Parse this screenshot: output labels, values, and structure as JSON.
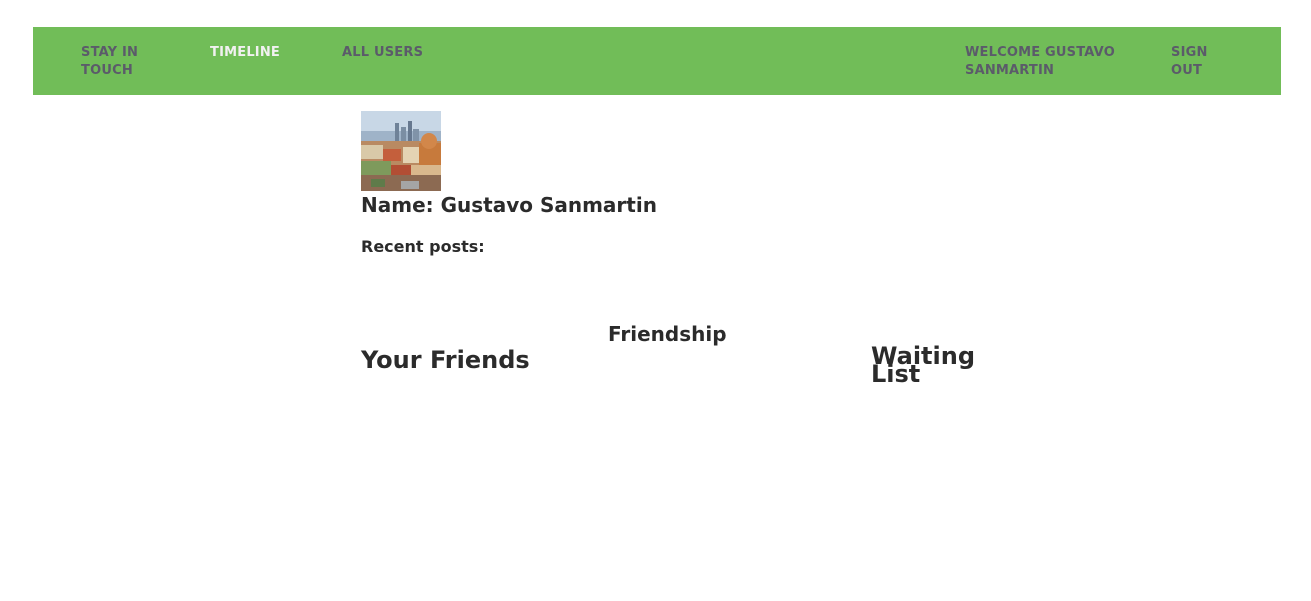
{
  "nav": {
    "brand": "STAY IN TOUCH",
    "timeline": "TIMELINE",
    "all_users": "ALL USERS",
    "welcome": "WELCOME GUSTAVO SANMARTIN",
    "sign_out": "SIGN OUT"
  },
  "profile": {
    "name": "Name: Gustavo Sanmartin",
    "recent_posts": "Recent posts:"
  },
  "friendship": {
    "title": "Friendship",
    "your_friends": "Your Friends",
    "waiting_list": "Waiting List"
  },
  "colors": {
    "navbar": "#71bd58",
    "nav_text": "#5b5b6a",
    "nav_active": "#f1f1f1"
  }
}
